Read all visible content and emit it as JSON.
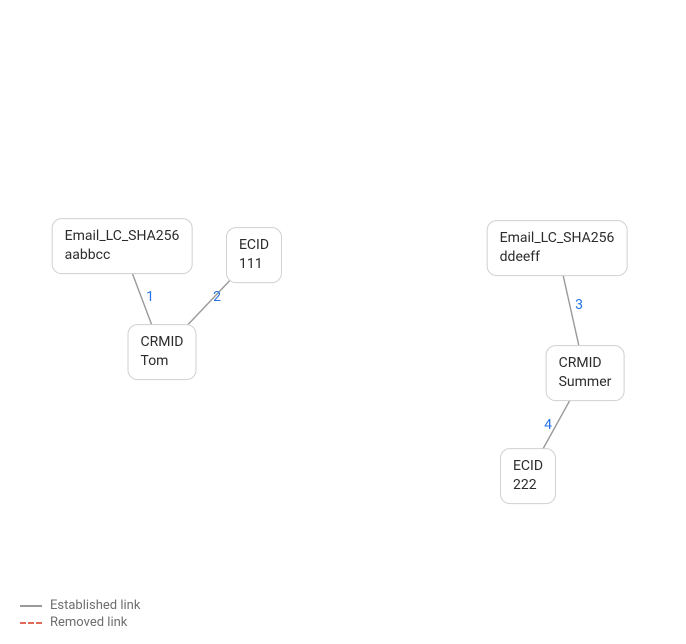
{
  "colors": {
    "established": "#9a9a9a",
    "removed": "#e06a5a",
    "edge_num": "#2673e6",
    "node_border": "#d0d0d0",
    "text": "#2c2c2c"
  },
  "nodes": {
    "email_left": {
      "line1": "Email_LC_SHA256",
      "line2": "aabbcc"
    },
    "ecid_111": {
      "line1": "ECID",
      "line2": "111"
    },
    "crmid_tom": {
      "line1": "CRMID",
      "line2": "Tom"
    },
    "email_right": {
      "line1": "Email_LC_SHA256",
      "line2": "ddeeff"
    },
    "crmid_summer": {
      "line1": "CRMID",
      "line2": "Summer"
    },
    "ecid_222": {
      "line1": "ECID",
      "line2": "222"
    }
  },
  "edges": {
    "e1": {
      "num": "1"
    },
    "e2": {
      "num": "2"
    },
    "e3": {
      "num": "3"
    },
    "e4": {
      "num": "4"
    }
  },
  "legend": {
    "established": "Established link",
    "removed": "Removed link"
  }
}
